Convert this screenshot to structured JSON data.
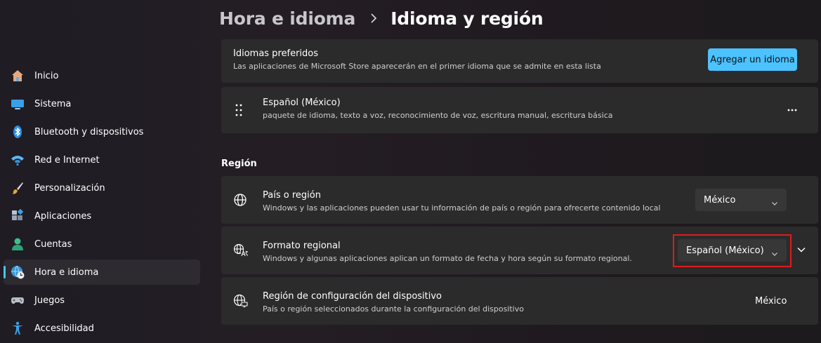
{
  "header": {
    "parent": "Hora e idioma",
    "current": "Idioma y región"
  },
  "sidebar": {
    "items": [
      {
        "label": "Inicio",
        "icon": "home-icon"
      },
      {
        "label": "Sistema",
        "icon": "monitor-icon"
      },
      {
        "label": "Bluetooth y dispositivos",
        "icon": "bluetooth-icon"
      },
      {
        "label": "Red e Internet",
        "icon": "wifi-icon"
      },
      {
        "label": "Personalización",
        "icon": "paintbrush-icon"
      },
      {
        "label": "Aplicaciones",
        "icon": "apps-icon"
      },
      {
        "label": "Cuentas",
        "icon": "person-icon"
      },
      {
        "label": "Hora e idioma",
        "icon": "globe-clock-icon",
        "active": true
      },
      {
        "label": "Juegos",
        "icon": "gamepad-icon"
      },
      {
        "label": "Accesibilidad",
        "icon": "accessibility-icon"
      }
    ]
  },
  "preferred_languages": {
    "title": "Idiomas preferidos",
    "subtitle": "Las aplicaciones de Microsoft Store aparecerán en el primer idioma que se admite en esta lista",
    "add_button": "Agregar un idioma"
  },
  "language_item": {
    "title": "Español (México)",
    "subtitle": "paquete de idioma, texto a voz, reconocimiento de voz, escritura manual, escritura básica"
  },
  "region_section": {
    "heading": "Región",
    "country": {
      "title": "País o región",
      "subtitle": "Windows y las aplicaciones pueden usar tu información de país o región para ofrecerte contenido local",
      "value": "México"
    },
    "regional_format": {
      "title": "Formato regional",
      "subtitle": "Windows y algunas aplicaciones aplican un formato de fecha y hora según su formato regional.",
      "value": "Español (México)"
    },
    "device_region": {
      "title": "Región de configuración del dispositivo",
      "subtitle": "País o región seleccionados durante la configuración del dispositivo",
      "value": "México"
    }
  },
  "colors": {
    "accent": "#4cc2ff",
    "card": "#2b2b2b",
    "highlight": "#e01c1c"
  }
}
